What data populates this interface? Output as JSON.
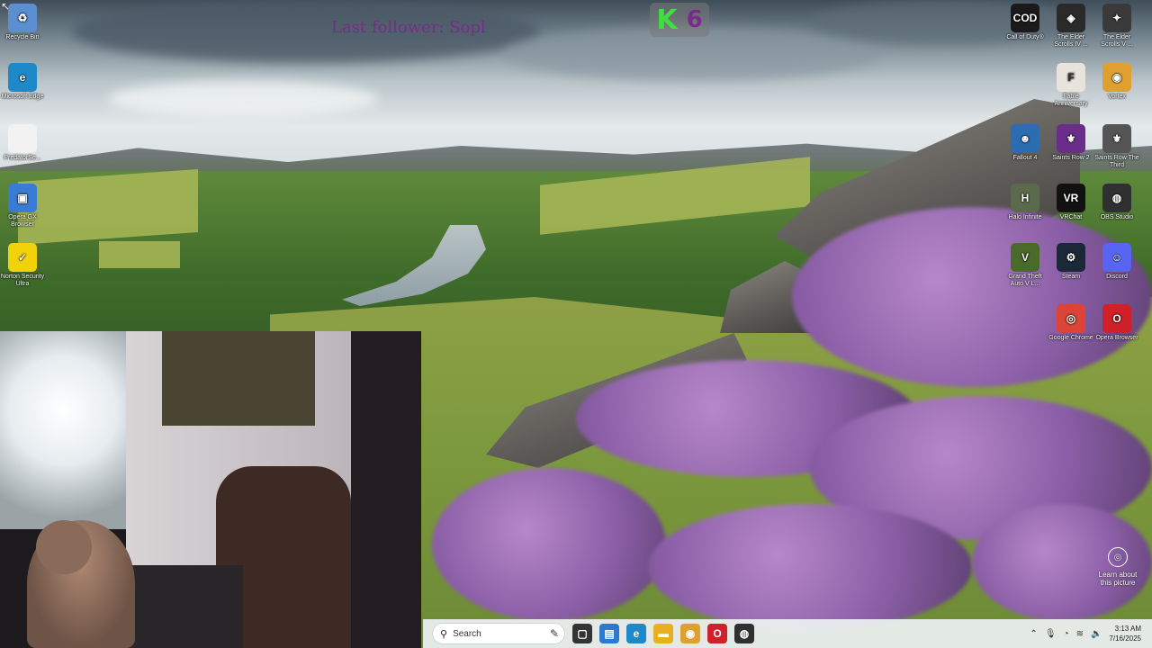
{
  "overlay": {
    "last_follower": "Last follower: Sopl",
    "counter_letter": "K",
    "counter_value": "6",
    "counter_letter_color": "#3ee03e",
    "counter_value_color": "#7a2a8a"
  },
  "desktop": {
    "left_icons": [
      {
        "label": "Recycle Bin",
        "icon": "recycle-bin-icon",
        "glyph": "♻",
        "color": "#5b8fd0"
      },
      {
        "label": "Microsoft Edge",
        "icon": "edge-icon",
        "glyph": "e",
        "color": "#1e88c8"
      },
      {
        "label": "PredatorSe...",
        "icon": "file-icon",
        "glyph": "",
        "color": "#f2f2f2"
      },
      {
        "label": "Opera GX Browser",
        "icon": "opera-gx-icon",
        "glyph": "▣",
        "color": "#3a7bd5"
      },
      {
        "label": "Norton Security Ultra",
        "icon": "norton-icon",
        "glyph": "✓",
        "color": "#f2d20a"
      }
    ],
    "right_icons": [
      {
        "label": "Call of Duty®",
        "icon": "call-of-duty-icon",
        "glyph": "COD",
        "color": "#1a1a1a"
      },
      {
        "label": "The Elder Scrolls IV ...",
        "icon": "elder-scrolls-iv-icon",
        "glyph": "◈",
        "color": "#2a2a2a"
      },
      {
        "label": "The Elder Scrolls V ...",
        "icon": "elder-scrolls-v-icon",
        "glyph": "✦",
        "color": "#3a3a3a"
      },
      {
        "label": "Fable Anniversary",
        "icon": "fable-icon",
        "glyph": "F",
        "color": "#e8e4dc"
      },
      {
        "label": "Vortex",
        "icon": "vortex-icon",
        "glyph": "◉",
        "color": "#e0a030"
      },
      {
        "label": "Fallout 4",
        "icon": "fallout-icon",
        "glyph": "☻",
        "color": "#2c6cb0"
      },
      {
        "label": "Saints Row 2",
        "icon": "saints-row-2-icon",
        "glyph": "⚜",
        "color": "#6a2d8a"
      },
      {
        "label": "Saints Row The Third",
        "icon": "saints-row-third-icon",
        "glyph": "⚜",
        "color": "#555555"
      },
      {
        "label": "Halo Infinite",
        "icon": "halo-icon",
        "glyph": "H",
        "color": "#5a6a4a"
      },
      {
        "label": "VRChat",
        "icon": "vrchat-icon",
        "glyph": "VR",
        "color": "#111111"
      },
      {
        "label": "OBS Studio",
        "icon": "obs-icon",
        "glyph": "◍",
        "color": "#303030"
      },
      {
        "label": "Grand Theft Auto V L...",
        "icon": "gta-icon",
        "glyph": "V",
        "color": "#4a6a2a"
      },
      {
        "label": "Steam",
        "icon": "steam-icon",
        "glyph": "⚙",
        "color": "#1b2838"
      },
      {
        "label": "Discord",
        "icon": "discord-icon",
        "glyph": "☺",
        "color": "#5865f2"
      },
      {
        "label": "Google Chrome",
        "icon": "chrome-icon",
        "glyph": "◎",
        "color": "#db4437"
      },
      {
        "label": "Opera Browser",
        "icon": "opera-icon",
        "glyph": "O",
        "color": "#d0202a"
      }
    ],
    "learn_about": "Learn about this picture"
  },
  "taskbar": {
    "search_placeholder": "Search",
    "apps": [
      {
        "name": "task-view-icon",
        "glyph": "▢",
        "color": "#333333"
      },
      {
        "name": "widget-icon",
        "glyph": "▤",
        "color": "#2a7bd0"
      },
      {
        "name": "edge-taskbar-icon",
        "glyph": "e",
        "color": "#1e88c8"
      },
      {
        "name": "file-explorer-icon",
        "glyph": "▬",
        "color": "#e8b020"
      },
      {
        "name": "vortex-taskbar-icon",
        "glyph": "◉",
        "color": "#e0a030"
      },
      {
        "name": "opera-taskbar-icon",
        "glyph": "O",
        "color": "#d0202a"
      },
      {
        "name": "obs-taskbar-icon",
        "glyph": "◍",
        "color": "#303030"
      }
    ],
    "time": "3:13 AM",
    "date": "7/16/2025"
  }
}
